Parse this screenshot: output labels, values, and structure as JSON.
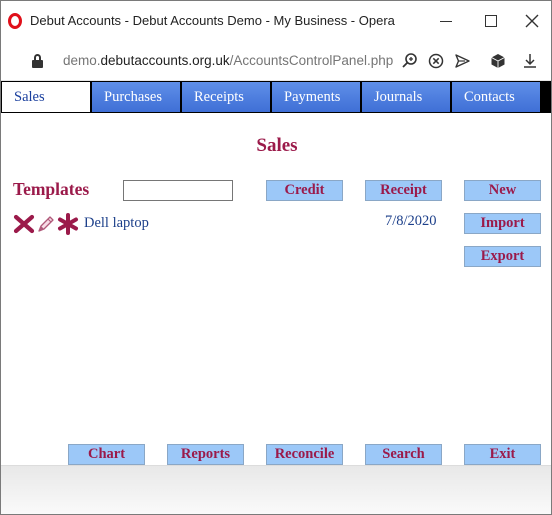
{
  "window": {
    "title": "Debut Accounts - Debut Accounts Demo - My Business - Opera"
  },
  "addressbar": {
    "url_prefix": "demo.",
    "url_domain": "debutaccounts.org.uk",
    "url_path": "/AccountsControlPanel.php"
  },
  "tabs": [
    {
      "label": "Sales",
      "active": true
    },
    {
      "label": "Purchases",
      "active": false
    },
    {
      "label": "Receipts",
      "active": false
    },
    {
      "label": "Payments",
      "active": false
    },
    {
      "label": "Journals",
      "active": false
    },
    {
      "label": "Contacts",
      "active": false
    }
  ],
  "page": {
    "title": "Sales",
    "templates_label": "Templates",
    "template_input_value": ""
  },
  "actions": {
    "credit": "Credit",
    "receipt": "Receipt",
    "new": "New",
    "import": "Import",
    "export": "Export"
  },
  "templates": [
    {
      "name": "Dell laptop",
      "date": "7/8/2020"
    }
  ],
  "bottom_buttons": {
    "chart": "Chart",
    "reports": "Reports",
    "reconcile": "Reconcile",
    "search": "Search",
    "exit": "Exit"
  },
  "colors": {
    "accent": "#9b1a4a",
    "button_bg": "#9cc8f8",
    "tab_bg": "#4f7fe0",
    "link": "#1c3f8a"
  },
  "icons": {
    "row_actions": [
      "delete-icon",
      "edit-icon",
      "copy-icon"
    ]
  }
}
